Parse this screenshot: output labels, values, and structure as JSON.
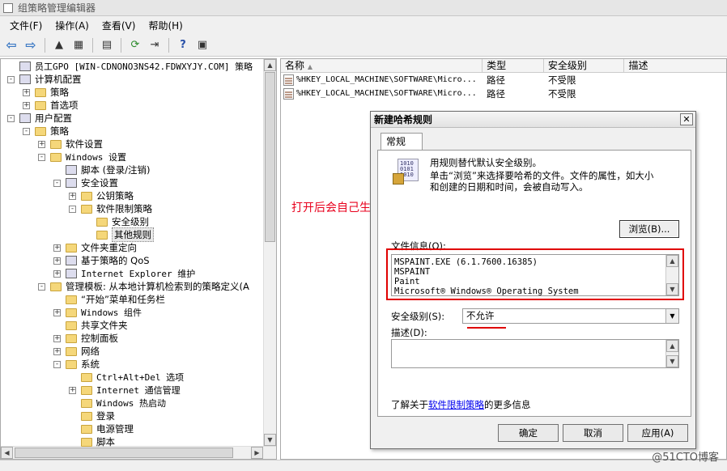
{
  "window": {
    "title": "组策略管理编辑器"
  },
  "menu": [
    "文件(F)",
    "操作(A)",
    "查看(V)",
    "帮助(H)"
  ],
  "tree": {
    "rows": [
      {
        "label": "员工GPO [WIN-CDNONO3NS42.FDWXYJY.COM] 策略",
        "level": 0,
        "expander": "none",
        "icon": "gpo-icon",
        "mono": true
      },
      {
        "label": "计算机配置",
        "level": 0,
        "expander": "-",
        "icon": "computer-icon"
      },
      {
        "label": "策略",
        "level": 1,
        "expander": "+",
        "icon": "folder-icon"
      },
      {
        "label": "首选项",
        "level": 1,
        "expander": "+",
        "icon": "folder-icon"
      },
      {
        "label": "用户配置",
        "level": 0,
        "expander": "-",
        "icon": "user-icon"
      },
      {
        "label": "策略",
        "level": 1,
        "expander": "-",
        "icon": "folder-icon"
      },
      {
        "label": "软件设置",
        "level": 2,
        "expander": "+",
        "icon": "folder-icon"
      },
      {
        "label": "Windows 设置",
        "level": 2,
        "expander": "-",
        "icon": "folder-icon",
        "mono": true
      },
      {
        "label": "脚本 (登录/注销)",
        "level": 3,
        "expander": "none",
        "icon": "script-icon"
      },
      {
        "label": "安全设置",
        "level": 3,
        "expander": "-",
        "icon": "shield-icon"
      },
      {
        "label": "公钥策略",
        "level": 4,
        "expander": "+",
        "icon": "folder-icon"
      },
      {
        "label": "软件限制策略",
        "level": 4,
        "expander": "-",
        "icon": "folder-icon"
      },
      {
        "label": "安全级别",
        "level": 5,
        "expander": "none",
        "icon": "folder-icon"
      },
      {
        "label": "其他规则",
        "level": 5,
        "expander": "none",
        "icon": "folder-icon",
        "selected": true
      },
      {
        "label": "文件夹重定向",
        "level": 3,
        "expander": "+",
        "icon": "folder-icon"
      },
      {
        "label": "基于策略的 QoS",
        "level": 3,
        "expander": "+",
        "icon": "chart-icon"
      },
      {
        "label": "Internet Explorer 维护",
        "level": 3,
        "expander": "+",
        "icon": "ie-icon",
        "mono": true
      },
      {
        "label": "管理模板: 从本地计算机检索到的策略定义(A",
        "level": 2,
        "expander": "-",
        "icon": "folder-icon"
      },
      {
        "label": "“开始”菜单和任务栏",
        "level": 3,
        "expander": "none",
        "icon": "folder-icon"
      },
      {
        "label": "Windows 组件",
        "level": 3,
        "expander": "+",
        "icon": "folder-icon",
        "mono": true
      },
      {
        "label": "共享文件夹",
        "level": 3,
        "expander": "none",
        "icon": "folder-icon"
      },
      {
        "label": "控制面板",
        "level": 3,
        "expander": "+",
        "icon": "folder-icon"
      },
      {
        "label": "网络",
        "level": 3,
        "expander": "+",
        "icon": "folder-icon"
      },
      {
        "label": "系统",
        "level": 3,
        "expander": "-",
        "icon": "folder-icon"
      },
      {
        "label": "Ctrl+Alt+Del 选项",
        "level": 4,
        "expander": "none",
        "icon": "folder-icon",
        "mono": true
      },
      {
        "label": "Internet 通信管理",
        "level": 4,
        "expander": "+",
        "icon": "folder-icon",
        "mono": true
      },
      {
        "label": "Windows 热启动",
        "level": 4,
        "expander": "none",
        "icon": "folder-icon",
        "mono": true
      },
      {
        "label": "登录",
        "level": 4,
        "expander": "none",
        "icon": "folder-icon"
      },
      {
        "label": "电源管理",
        "level": 4,
        "expander": "none",
        "icon": "folder-icon"
      },
      {
        "label": "脚本",
        "level": 4,
        "expander": "none",
        "icon": "folder-icon"
      }
    ]
  },
  "list": {
    "headers": [
      "名称",
      "类型",
      "安全级别",
      "描述"
    ],
    "rows": [
      {
        "name": "%HKEY_LOCAL_MACHINE\\SOFTWARE\\Micro...",
        "type": "路径",
        "level": "不受限",
        "desc": ""
      },
      {
        "name": "%HKEY_LOCAL_MACHINE\\SOFTWARE\\Micro...",
        "type": "路径",
        "level": "不受限",
        "desc": ""
      }
    ]
  },
  "annotation": "打开后会自己生成哈希值",
  "dialog": {
    "title": "新建哈希规则",
    "tab": "常规",
    "desc1": "用规则替代默认安全级别。",
    "desc2": "单击“浏览”来选择要哈希的文件。文件的属性，如大小",
    "desc3": "和创建的日期和时间，会被自动写入。",
    "browse_label": "浏览(B)...",
    "file_info_label": "文件信息(O):",
    "file_info": [
      "MSPAINT.EXE (6.1.7600.16385)",
      "MSPAINT",
      "Paint",
      "Microsoft® Windows® Operating System"
    ],
    "security_label": "安全级别(S):",
    "security_value": "不允许",
    "desc_label": "描述(D):",
    "desc_value": "",
    "more_info_prefix": "了解关于",
    "more_info_link": "软件限制策略",
    "more_info_suffix": "的更多信息",
    "ok": "确定",
    "cancel": "取消",
    "apply": "应用(A)",
    "close": "✕",
    "binary_glyph": "1010 0101 1010"
  },
  "watermark": "@51CTO博客"
}
